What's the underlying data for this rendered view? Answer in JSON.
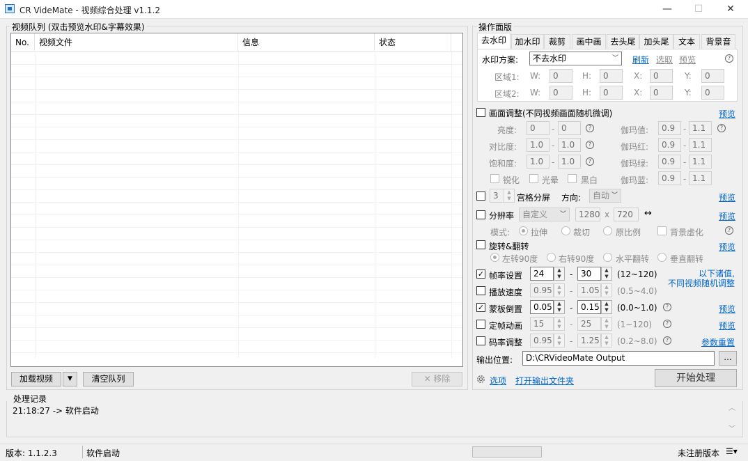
{
  "window": {
    "title": "CR VideMate - 视频综合处理 v1.1.2",
    "min": "—",
    "max": "☐",
    "close": "✕"
  },
  "queue": {
    "group_label": "视频队列 (双击预览水印&字幕效果)",
    "columns": [
      "No.",
      "视频文件",
      "信息",
      "状态"
    ],
    "load_btn": "加载视频",
    "dropdown": "▼",
    "clear_btn": "清空队列",
    "remove_btn": "✕ 移除"
  },
  "panel": {
    "group_label": "操作面版",
    "tabs": [
      "去水印",
      "加水印",
      "裁剪",
      "画中画",
      "去头尾",
      "加头尾",
      "文本",
      "背景音"
    ],
    "watermark": {
      "scheme_label": "水印方案:",
      "scheme_value": "不去水印",
      "refresh": "刷新",
      "pick": "选取",
      "preview": "预览",
      "regions": [
        {
          "label": "区域1:",
          "w": "0",
          "h": "0",
          "x": "0",
          "y": "0"
        },
        {
          "label": "区域2:",
          "w": "0",
          "h": "0",
          "x": "0",
          "y": "0"
        }
      ],
      "w_label": "W:",
      "h_label": "H:",
      "x_label": "X:",
      "y_label": "Y:"
    },
    "picture": {
      "label": "画面调整(不同视频画面随机微调)",
      "preview": "预览",
      "brightness": {
        "label": "亮度:",
        "a": "0",
        "b": "0"
      },
      "contrast": {
        "label": "对比度:",
        "a": "1.0",
        "b": "1.0"
      },
      "saturation": {
        "label": "饱和度:",
        "a": "1.0",
        "b": "1.0"
      },
      "gamma": {
        "label": "伽玛值:",
        "a": "0.9",
        "b": "1.1"
      },
      "gamma_r": {
        "label": "伽玛红:",
        "a": "0.9",
        "b": "1.1"
      },
      "gamma_g": {
        "label": "伽玛绿:",
        "a": "0.9",
        "b": "1.1"
      },
      "gamma_b": {
        "label": "伽玛蓝:",
        "a": "0.9",
        "b": "1.1"
      },
      "sharpen": "锐化",
      "glow": "光晕",
      "bw": "黑白",
      "dash": "-"
    },
    "grid": {
      "count": "3",
      "label": "宫格分屏",
      "dir_label": "方向:",
      "dir_value": "自动",
      "preview": "预览"
    },
    "resolution": {
      "label": "分辨率",
      "mode_value": "自定义",
      "w": "1280",
      "x": "x",
      "h": "720",
      "swap": "↔",
      "preview": "预览",
      "mode_label": "模式:",
      "stretch": "拉伸",
      "crop": "裁切",
      "ratio": "原比例",
      "blur_bg": "背景虚化"
    },
    "rotate": {
      "label": "旋转&翻转",
      "preview": "预览",
      "left90": "左转90度",
      "right90": "右转90度",
      "hflip": "水平翻转",
      "vflip": "垂直翻转"
    },
    "framerate": {
      "label": "帧率设置",
      "a": "24",
      "b": "30",
      "range": "(12~120)"
    },
    "note": {
      "line1": "以下诸值,",
      "line2": "不同视频随机调整"
    },
    "speed": {
      "label": "播放速度",
      "a": "0.95",
      "b": "1.05",
      "range": "(0.5~4.0)"
    },
    "mask": {
      "label": "蒙板倒置",
      "a": "0.05",
      "b": "0.15",
      "range": "(0.0~1.0)",
      "preview": "预览"
    },
    "freeze": {
      "label": "定帧动画",
      "a": "15",
      "b": "25",
      "range": "(1~120)",
      "preview": "预览"
    },
    "bitrate": {
      "label": "码率调整",
      "a": "0.95",
      "b": "1.25",
      "range": "(0.2~8.0)",
      "reset": "参数重置"
    },
    "output": {
      "label": "输出位置:",
      "path": "D:\\CRVideoMate Output",
      "browse": "..."
    },
    "options": "选项",
    "open_folder": "打开输出文件夹",
    "start": "开始处理"
  },
  "log": {
    "label": "处理记录",
    "entries": [
      "21:18:27 -> 软件启动"
    ]
  },
  "statusbar": {
    "version": "版本: 1.1.2.3",
    "state": "软件启动",
    "reg": "未注册版本"
  }
}
